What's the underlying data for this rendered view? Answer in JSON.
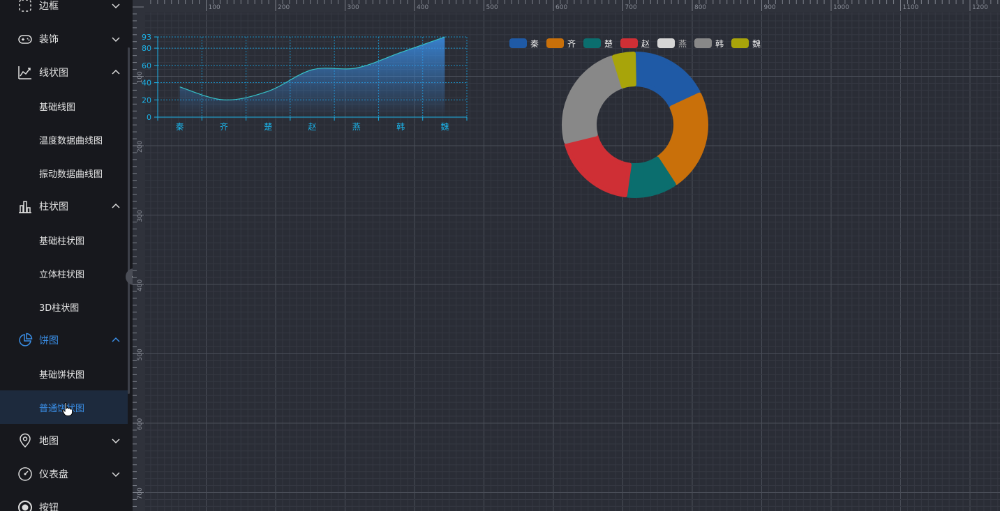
{
  "sidebar": {
    "items": [
      {
        "label": "边框",
        "icon": "dashed-square-icon",
        "expanded": false
      },
      {
        "label": "装饰",
        "icon": "gamepad-icon",
        "expanded": false
      },
      {
        "label": "线状图",
        "icon": "line-chart-icon",
        "expanded": true,
        "children": [
          {
            "label": "基础线图"
          },
          {
            "label": "温度数据曲线图"
          },
          {
            "label": "振动数据曲线图"
          }
        ]
      },
      {
        "label": "柱状图",
        "icon": "bar-chart-icon",
        "expanded": true,
        "children": [
          {
            "label": "基础柱状图"
          },
          {
            "label": "立体柱状图"
          },
          {
            "label": "3D柱状图"
          }
        ]
      },
      {
        "label": "饼图",
        "icon": "pie-chart-icon",
        "expanded": true,
        "active": true,
        "children": [
          {
            "label": "基础饼状图"
          },
          {
            "label": "普通饼状图",
            "selected": true
          }
        ]
      },
      {
        "label": "地图",
        "icon": "map-pin-icon",
        "expanded": false
      },
      {
        "label": "仪表盘",
        "icon": "gauge-icon",
        "expanded": false
      },
      {
        "label": "按钮",
        "icon": "radio-button-icon",
        "expanded": false
      }
    ]
  },
  "rulers": {
    "top_ticks": [
      "0",
      "100",
      "200",
      "300",
      "400",
      "500",
      "600",
      "700",
      "800",
      "900",
      "1000",
      "1100",
      "1200"
    ],
    "left_ticks": [
      "100",
      "200",
      "300",
      "400",
      "500",
      "600",
      "700"
    ]
  },
  "colors": {
    "accent": "#3a8ee6",
    "grid_major": "#4a4e58",
    "grid_minor": "#353842",
    "chart_axis": "#1bb1e6"
  },
  "chart_data": [
    {
      "type": "area",
      "categories": [
        "秦",
        "齐",
        "楚",
        "赵",
        "燕",
        "韩",
        "魏"
      ],
      "values": [
        35,
        20,
        30,
        55,
        57,
        75,
        93
      ],
      "ylim": [
        0,
        93
      ],
      "yticks": [
        "0",
        "20",
        "40",
        "60",
        "80",
        "93"
      ],
      "grid": true,
      "line_color": "#36c2c8",
      "fill_color": "#3a8ee6"
    },
    {
      "type": "pie",
      "donut": true,
      "categories": [
        "秦",
        "齐",
        "楚",
        "赵",
        "燕",
        "韩",
        "魏"
      ],
      "values": [
        14,
        18,
        9,
        15,
        0,
        19,
        4
      ],
      "colors": [
        "#1f5aa6",
        "#c9700a",
        "#0b6e6e",
        "#cf2f35",
        "#d6d6d6",
        "#888888",
        "#a8a40a"
      ],
      "legend_position": "top"
    }
  ]
}
